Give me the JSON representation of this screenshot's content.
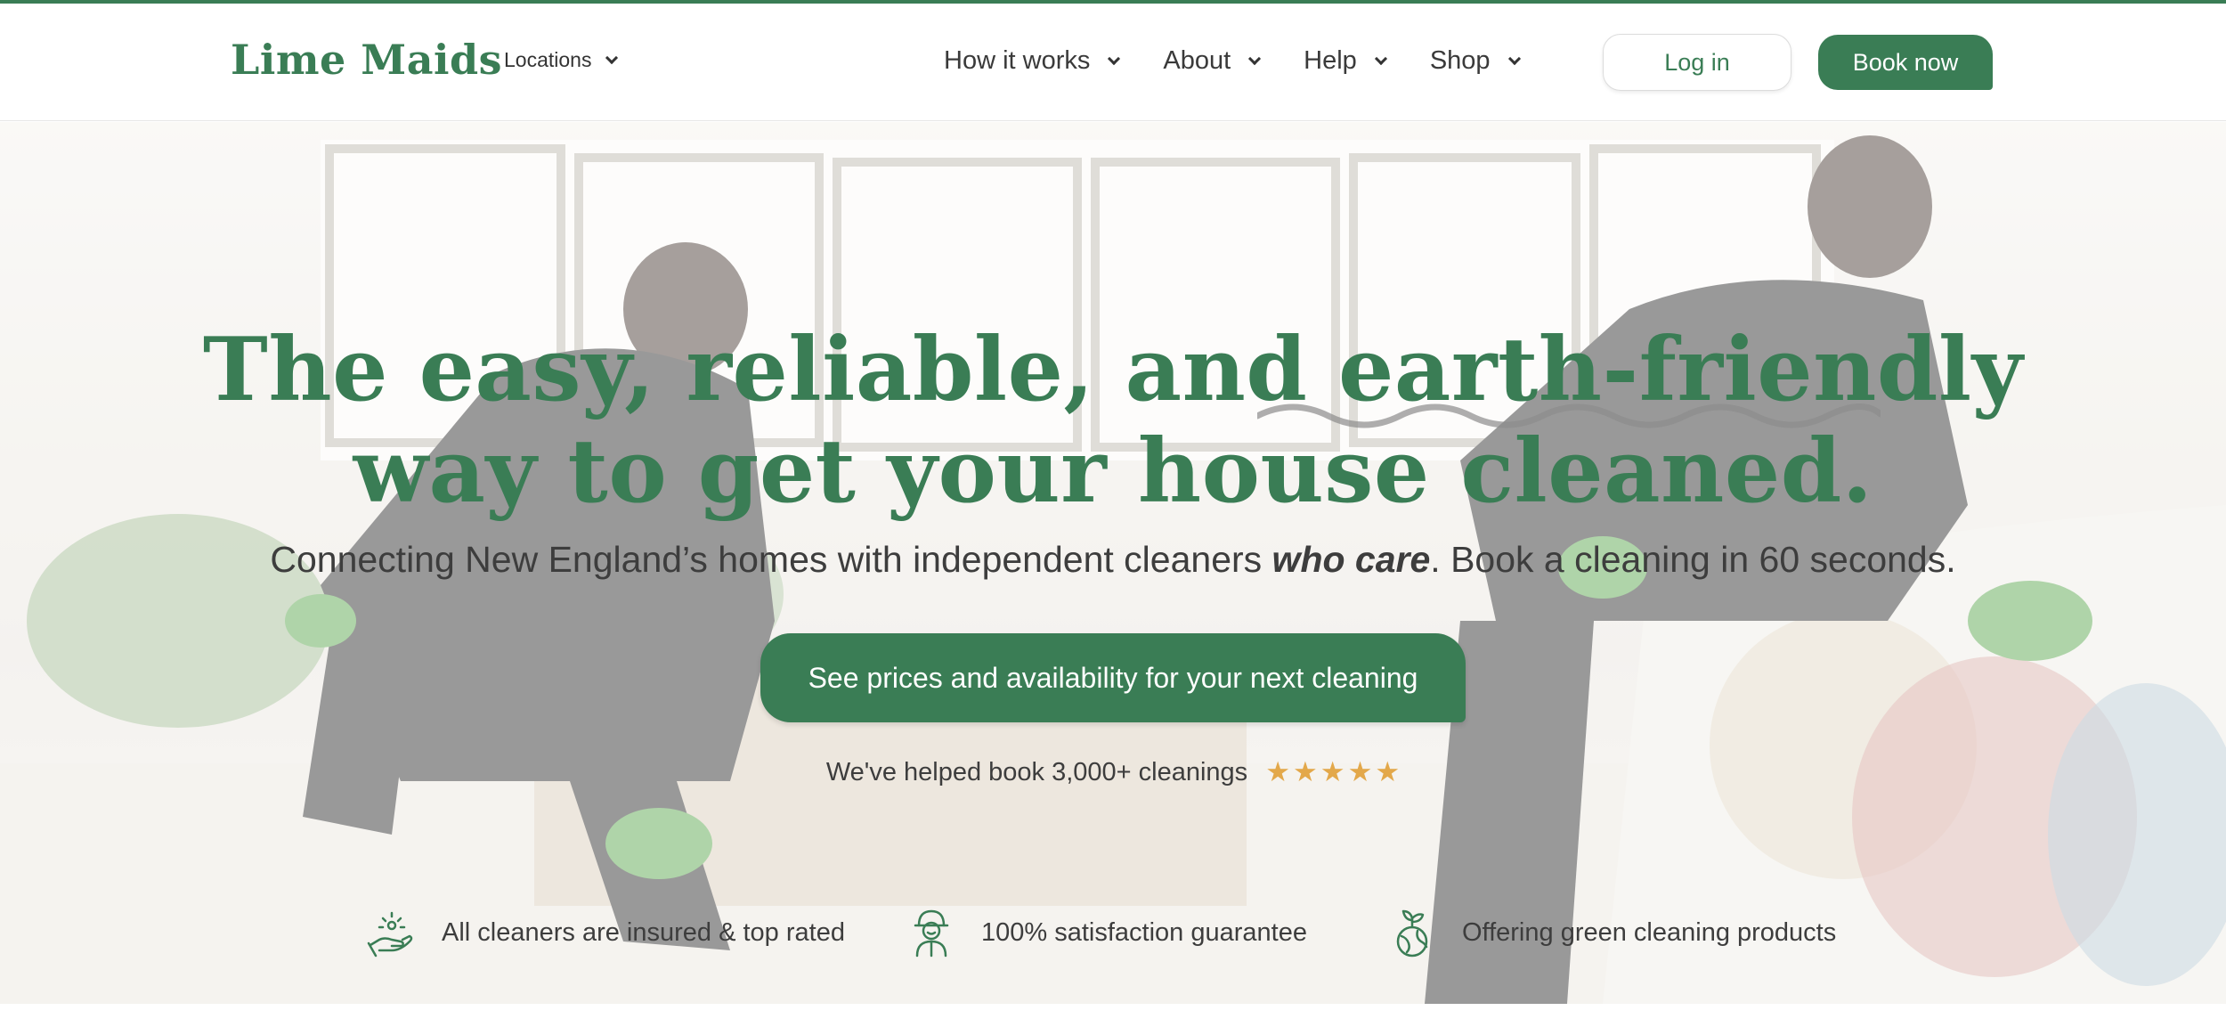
{
  "header": {
    "logo": "Lime Maids",
    "locations_label": "Locations",
    "nav": [
      {
        "label": "How it works"
      },
      {
        "label": "About"
      },
      {
        "label": "Help"
      },
      {
        "label": "Shop"
      }
    ],
    "login_label": "Log in",
    "book_label": "Book now"
  },
  "hero": {
    "headline_line1": "The easy, reliable, and earth-friendly",
    "headline_line2": "way to get your house cleaned.",
    "subhead_pre": "Connecting New England’s homes with independent cleaners ",
    "subhead_em": "who care",
    "subhead_post": ". Book a cleaning in 60 seconds.",
    "cta_label": "See prices and availability for your next cleaning",
    "rating_text": "We've helped book 3,000+ cleanings",
    "rating_stars": 5
  },
  "features": [
    {
      "icon": "insured-hand-icon",
      "text": "All cleaners are insured & top rated"
    },
    {
      "icon": "satisfaction-person-icon",
      "text": "100% satisfaction guarantee"
    },
    {
      "icon": "green-globe-sprout-icon",
      "text": "Offering green cleaning products"
    }
  ],
  "colors": {
    "brand_green": "#3a7d55",
    "star_gold": "#e3a84a",
    "text_dark": "#3d3d3d"
  }
}
